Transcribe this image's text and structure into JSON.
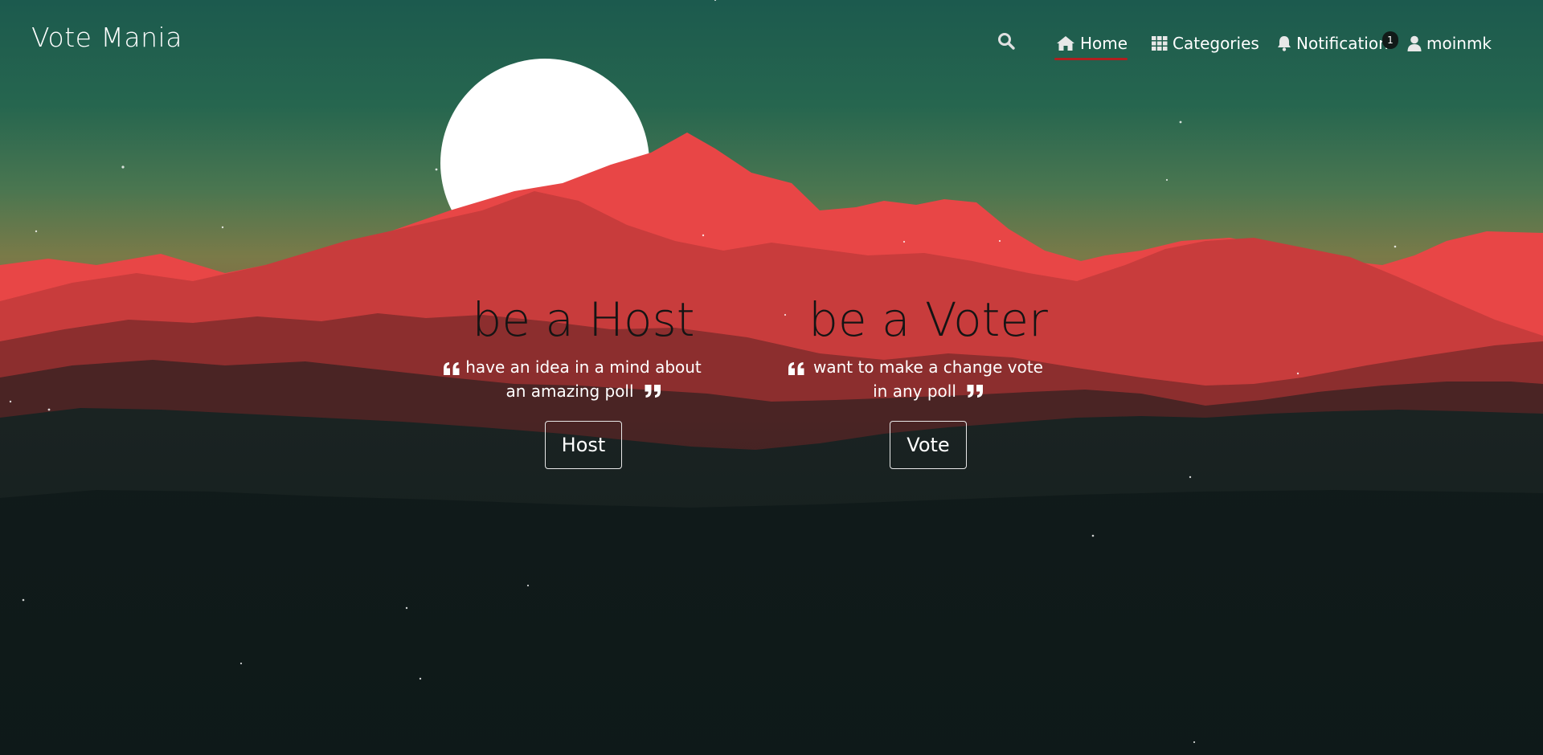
{
  "app": {
    "brand": "Vote Mania"
  },
  "nav": {
    "search_icon": "search-icon",
    "items": [
      {
        "label": "Home",
        "icon": "home-icon",
        "active": true
      },
      {
        "label": "Categories",
        "icon": "grid-icon"
      },
      {
        "label": "Notification",
        "icon": "bell-icon",
        "badge": "1"
      },
      {
        "label": "moinmk",
        "icon": "user-icon"
      }
    ]
  },
  "hero": {
    "host": {
      "title": "be a Host",
      "quote": "have an idea in a mind about an amazing poll",
      "button": "Host"
    },
    "voter": {
      "title": "be a Voter",
      "quote": "want to make a change vote in any poll",
      "button": "Vote"
    }
  },
  "colors": {
    "sky_top": "#1c5a4e",
    "sky_horizon": "#7a7a48",
    "mountain_red": "#e84646",
    "mountain_dark": "#0c1818",
    "active_underline": "#b01f1f"
  }
}
